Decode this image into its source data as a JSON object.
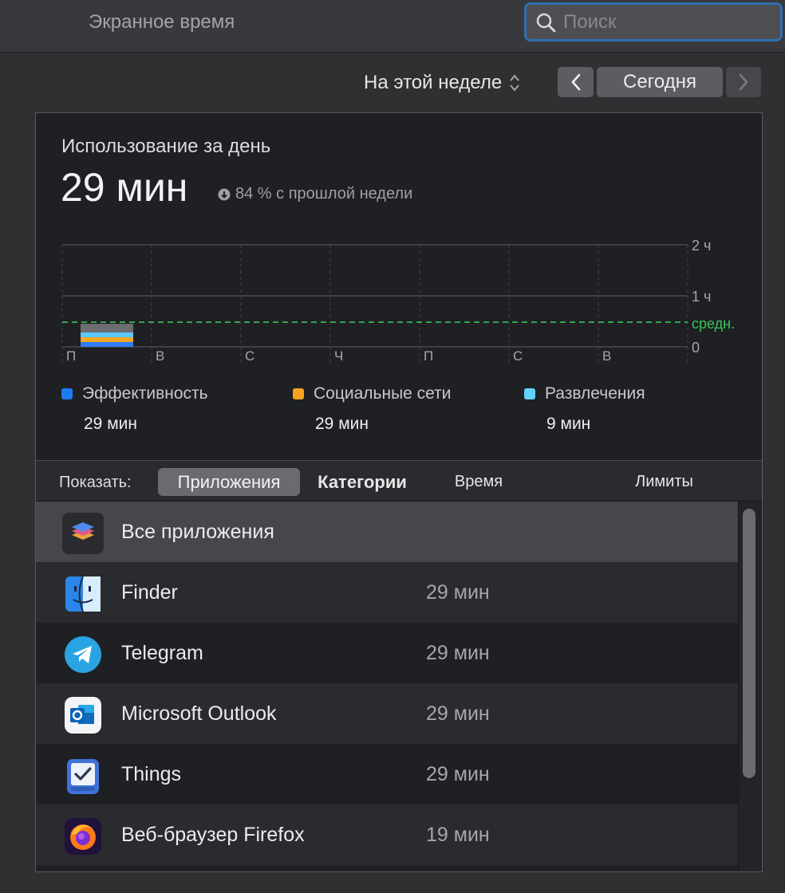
{
  "window": {
    "title": "Экранное время"
  },
  "search": {
    "placeholder": "Поиск",
    "value": ""
  },
  "toolbar": {
    "period": "На этой неделе",
    "today": "Сегодня"
  },
  "summary": {
    "title": "Использование за день",
    "total": "29 мин",
    "trend": "84 % с прошлой недели"
  },
  "chart_data": {
    "type": "bar",
    "categories": [
      "П",
      "В",
      "С",
      "Ч",
      "П",
      "С",
      "В"
    ],
    "y_ticks": [
      "2 ч",
      "1 ч",
      "0"
    ],
    "ylim_minutes": [
      0,
      120
    ],
    "average_label": "средн.",
    "average_minutes": 29,
    "series": [
      {
        "name": "Эффективность",
        "color": "#2f7cf6",
        "values": [
          29,
          0,
          0,
          0,
          0,
          0,
          0
        ]
      },
      {
        "name": "Социальные сети",
        "color": "#f5a623",
        "values": [
          29,
          0,
          0,
          0,
          0,
          0,
          0
        ]
      },
      {
        "name": "Развлечения",
        "color": "#5ac8fa",
        "values": [
          9,
          0,
          0,
          0,
          0,
          0,
          0
        ]
      }
    ],
    "grid": true
  },
  "legend": [
    {
      "label": "Эффективность",
      "value": "29 мин",
      "color": "#1e7cf2"
    },
    {
      "label": "Социальные сети",
      "value": "29 мин",
      "color": "#f7a21e"
    },
    {
      "label": "Развлечения",
      "value": "9 мин",
      "color": "#64d2ff"
    }
  ],
  "tabs": {
    "show_label": "Показать:",
    "apps": "Приложения",
    "categories": "Категории",
    "time": "Время",
    "limits": "Лимиты"
  },
  "apps": [
    {
      "name": "Все приложения",
      "time": "",
      "icon": "all-apps-icon"
    },
    {
      "name": "Finder",
      "time": "29 мин",
      "icon": "finder-icon"
    },
    {
      "name": "Telegram",
      "time": "29 мин",
      "icon": "telegram-icon"
    },
    {
      "name": "Microsoft Outlook",
      "time": "29 мин",
      "icon": "outlook-icon"
    },
    {
      "name": "Things",
      "time": "29 мин",
      "icon": "things-icon"
    },
    {
      "name": "Веб-браузер Firefox",
      "time": "19 мин",
      "icon": "firefox-icon"
    }
  ],
  "colors": {
    "accent": "#2f6fb0",
    "average_line": "#39c45a"
  }
}
